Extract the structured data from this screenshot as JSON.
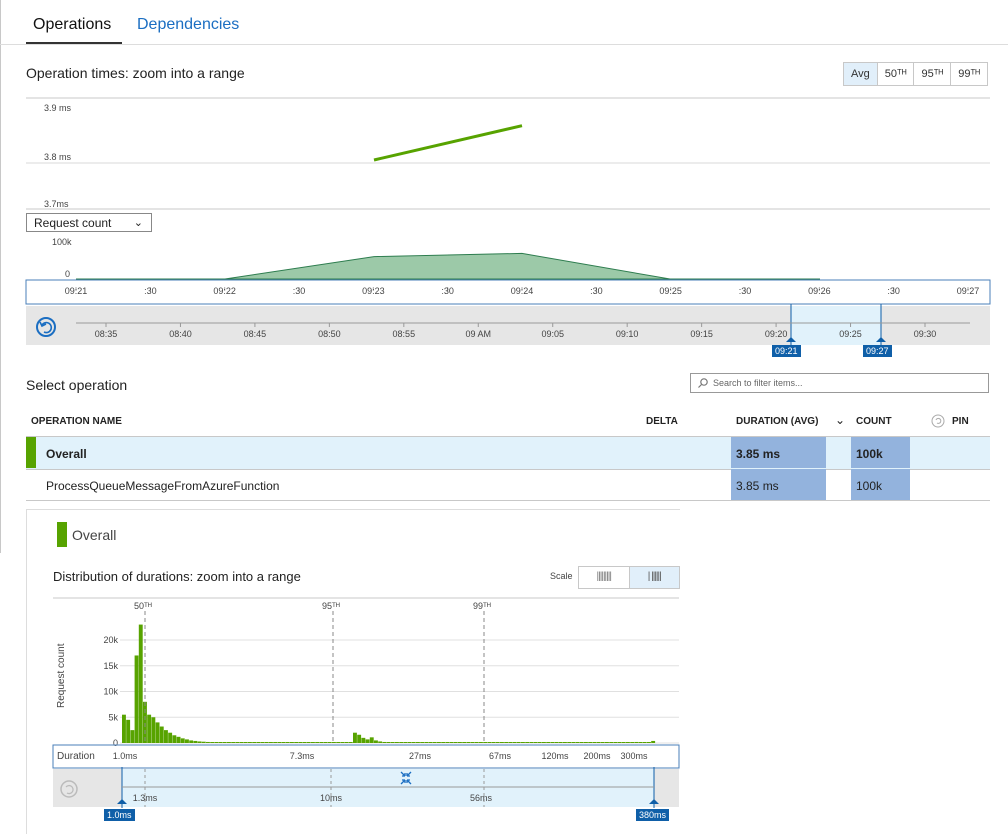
{
  "tabs": [
    {
      "label": "Operations",
      "active": true
    },
    {
      "label": "Dependencies",
      "active": false
    }
  ],
  "operation_times": {
    "title": "Operation times: zoom into a range",
    "percentile_options": [
      "Avg",
      "50ᵀᴴ",
      "95ᵀᴴ",
      "99ᵀᴴ"
    ],
    "selected_percentile": "Avg"
  },
  "metric_select": {
    "value": "Request count"
  },
  "time_axis_labels": [
    "09:21",
    ":30",
    "09:22",
    ":30",
    "09:23",
    ":30",
    "09:24",
    ":30",
    "09:25",
    ":30",
    "09:26",
    ":30",
    "09:27"
  ],
  "overview_axis_labels": [
    "08:35",
    "08:40",
    "08:45",
    "08:50",
    "08:55",
    "09 AM",
    "09:05",
    "09:10",
    "09:15",
    "09:20",
    "09:25",
    "09:30"
  ],
  "range_start_label": "09:21",
  "range_end_label": "09:27",
  "select_operation": {
    "title": "Select operation",
    "search_placeholder": "Search to filter items...",
    "columns": {
      "name": "OPERATION NAME",
      "delta": "DELTA",
      "duration": "DURATION (AVG)",
      "count": "COUNT",
      "pin": "PIN"
    },
    "rows": [
      {
        "name": "Overall",
        "duration": "3.85 ms",
        "count": "100k",
        "selected": true
      },
      {
        "name": "ProcessQueueMessageFromAzureFunction",
        "duration": "3.85 ms",
        "count": "100k",
        "selected": false
      }
    ]
  },
  "overall_panel": {
    "label": "Overall",
    "dist_title": "Distribution of durations: zoom into a range",
    "scale_label": "Scale",
    "y_axis_label": "Request count",
    "percentile_markers": [
      "50ᵀᴴ",
      "95ᵀᴴ",
      "99ᵀᴴ"
    ],
    "duration_label": "Duration",
    "duration_ticks": [
      "1.0ms",
      "7.3ms",
      "27ms",
      "67ms",
      "120ms",
      "200ms",
      "300ms"
    ],
    "range_ticks": [
      "1.3ms",
      "10ms",
      "56ms"
    ],
    "range_start_label": "1.0ms",
    "range_end_label": "380ms"
  },
  "colors": {
    "accent": "#57a300",
    "link": "#1b6ec2",
    "highlight_row": "#e1f2fb",
    "cell_blue": "#93b3dd",
    "area_fill": "#9cc9a8",
    "area_stroke": "#2e7d4f"
  },
  "chart_data": [
    {
      "type": "line",
      "title": "Operation times: zoom into a range",
      "x": [
        "09:23",
        "09:24"
      ],
      "series": [
        {
          "values": [
            3.8,
            3.87
          ]
        }
      ],
      "y_ticks": [
        "3.9 ms",
        "3.8 ms",
        "3.7ms"
      ],
      "ylim": [
        3.7,
        3.9
      ]
    },
    {
      "type": "area",
      "x": [
        "09:21",
        "09:22",
        "09:23",
        "09:24",
        "09:25",
        "09:26"
      ],
      "series": [
        {
          "name": "Request count",
          "values": [
            0,
            0,
            70000,
            80000,
            0,
            0
          ]
        }
      ],
      "y_ticks": [
        "100k",
        "0"
      ],
      "ylim": [
        0,
        100000
      ]
    },
    {
      "type": "bar",
      "title": "Distribution of durations: zoom into a range",
      "ylabel": "Request count",
      "xlabel": "Duration",
      "y_ticks": [
        "20k",
        "15k",
        "10k",
        "5k",
        "0"
      ],
      "ylim": [
        0,
        23500
      ],
      "values": [
        5500,
        4500,
        2500,
        17000,
        23000,
        8000,
        5500,
        5000,
        4000,
        3200,
        2500,
        2000,
        1500,
        1200,
        900,
        700,
        500,
        400,
        300,
        250,
        200,
        150,
        120,
        100,
        80,
        70,
        60,
        50,
        40,
        30,
        25,
        20,
        20,
        20,
        20,
        20,
        20,
        20,
        20,
        20,
        20,
        20,
        20,
        20,
        20,
        20,
        20,
        20,
        20,
        20,
        20,
        20,
        20,
        20,
        20,
        2000,
        1600,
        1000,
        700,
        1100,
        500,
        300,
        200,
        150,
        100,
        80,
        60,
        40,
        30,
        20,
        20,
        20,
        20,
        20,
        20,
        20,
        20,
        20,
        20,
        20,
        20,
        20,
        20,
        20,
        20,
        20,
        20,
        20,
        20,
        20,
        20,
        20,
        20,
        20,
        20,
        20,
        20,
        20,
        20,
        20,
        20,
        20,
        20,
        20,
        20,
        20,
        20,
        20,
        20,
        20,
        20,
        20,
        20,
        20,
        20,
        20,
        20,
        20,
        20,
        20,
        20,
        20,
        200,
        20,
        20,
        20,
        400
      ]
    }
  ]
}
